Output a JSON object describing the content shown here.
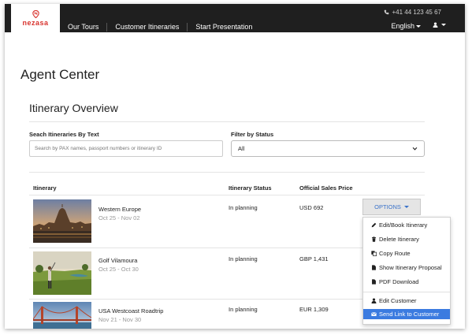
{
  "header": {
    "logo_text": "nezasa",
    "phone": "+41 44 123 45 67",
    "nav": [
      "Our Tours",
      "Customer Itineraries",
      "Start Presentation"
    ],
    "language": "English",
    "brand_color": "#d8322d"
  },
  "page": {
    "title": "Agent Center",
    "section_title": "Itinerary Overview"
  },
  "filters": {
    "search_label": "Seach Itineraries By Text",
    "search_placeholder": "Search by PAX names, passport numbers or itinerary ID",
    "status_label": "Filter by Status",
    "status_value": "All"
  },
  "table": {
    "headers": [
      "Itinerary",
      "Itinerary Status",
      "Official Sales Price"
    ],
    "rows": [
      {
        "name": "Western Europe",
        "dates": "Oct 25 - Nov 02",
        "status": "In planning",
        "price": "USD 692",
        "image": "rome-at-dusk"
      },
      {
        "name": "Golf Vilamoura",
        "dates": "Oct 25 - Oct 30",
        "status": "In planning",
        "price": "GBP 1,431",
        "image": "golfer-on-course"
      },
      {
        "name": "USA Westcoast Roadtrip",
        "dates": "Nov 21 - Nov 30",
        "status": "In planning",
        "price": "EUR 1,309",
        "image": "golden-gate-bridge"
      }
    ]
  },
  "options": {
    "button_label": "OPTIONS",
    "items": [
      {
        "label": "Edit/Book Itinerary",
        "icon": "pencil-icon"
      },
      {
        "label": "Delete Itinerary",
        "icon": "trash-icon"
      },
      {
        "label": "Copy Route",
        "icon": "copy-icon"
      },
      {
        "label": "Show Itinerary Proposal",
        "icon": "file-icon"
      },
      {
        "label": "PDF Download",
        "icon": "file-icon"
      },
      {
        "label": "Edit Customer",
        "icon": "user-icon"
      },
      {
        "label": "Send Link to Customer",
        "icon": "envelope-icon",
        "active": true
      }
    ],
    "accent_color": "#3b7be0"
  }
}
